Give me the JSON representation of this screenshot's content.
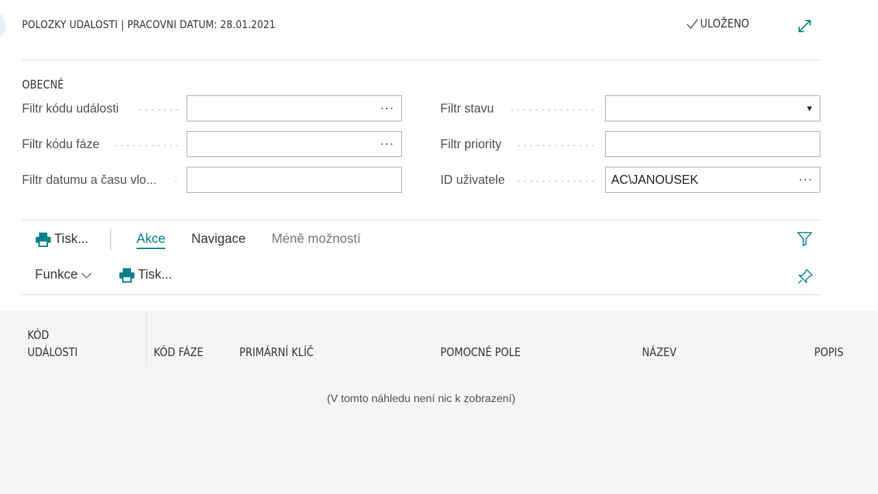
{
  "header": {
    "title": "POLOZKY UDALOSTI | PRACOVNI DATUM: 28.01.2021",
    "saved_label": "ULOŽENO"
  },
  "general": {
    "section_title": "OBECNÉ",
    "fields_left": [
      {
        "label": "Filtr kódu události",
        "value": ""
      },
      {
        "label": "Filtr kódu fáze",
        "value": ""
      },
      {
        "label": "Filtr datumu a času vlo...",
        "value": ""
      }
    ],
    "fields_right": [
      {
        "label": "Filtr stavu",
        "value": ""
      },
      {
        "label": "Filtr priority",
        "value": ""
      },
      {
        "label": "ID uživatele",
        "value": "AC\\JANOUSEK"
      }
    ]
  },
  "actions": {
    "print_label": "Tisk...",
    "akce": "Akce",
    "navigace": "Navigace",
    "less_options": "Méně možností",
    "funkce": "Funkce",
    "print_label2": "Tisk..."
  },
  "table": {
    "columns": [
      "KÓD\nUDÁLOSTI",
      "KÓD FÁZE",
      "PRIMÁRNÍ KLÍČ",
      "POMOCNÉ POLE",
      "NÁZEV",
      "POPIS"
    ],
    "col1_line1": "KÓD",
    "col1_line2": "UDÁLOSTI",
    "empty_message": "(V tomto náhledu není nic k zobrazení)"
  },
  "colors": {
    "accent": "#00808a",
    "table_bg": "#f4f5f7"
  }
}
